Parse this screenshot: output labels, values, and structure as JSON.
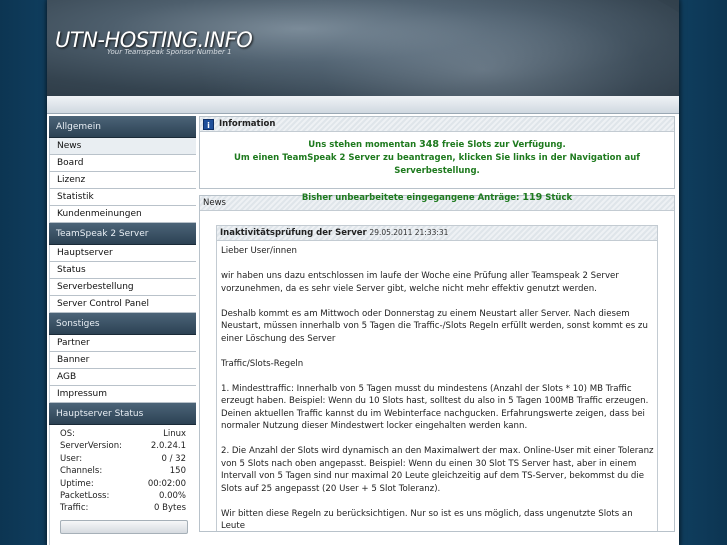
{
  "header": {
    "logo": "UTN-HOSTING.INFO",
    "tagline": "Your Teamspeak Sponsor Number 1"
  },
  "sidebar": {
    "sections": [
      {
        "title": "Allgemein",
        "items": [
          "News",
          "Board",
          "Lizenz",
          "Statistik",
          "Kundenmeinungen"
        ]
      },
      {
        "title": "TeamSpeak 2 Server",
        "items": [
          "Hauptserver",
          "Status",
          "Serverbestellung",
          "Server Control Panel"
        ]
      },
      {
        "title": "Sonstiges",
        "items": [
          "Partner",
          "Banner",
          "AGB",
          "Impressum"
        ]
      }
    ],
    "status": {
      "title": "Hauptserver Status",
      "rows": [
        {
          "label": "OS:",
          "value": "Linux"
        },
        {
          "label": "ServerVersion:",
          "value": "2.0.24.1"
        },
        {
          "label": "User:",
          "value": "0 / 32"
        },
        {
          "label": "Channels:",
          "value": "150"
        },
        {
          "label": "Uptime:",
          "value": "00:02:00"
        },
        {
          "label": "PacketLoss:",
          "value": "0.00%"
        },
        {
          "label": "Traffic:",
          "value": "0 Bytes"
        }
      ]
    }
  },
  "info": {
    "title": "Information",
    "line1_pre": "Uns stehen momentan",
    "free_slots": "348",
    "line1_post": "freie Slots zur Verfügung.",
    "line2": "Um einen TeamSpeak 2 Server zu beantragen, klicken Sie links in der Navigation auf Serverbestellung.",
    "line3_pre": "Bisher unbearbeitete eingegangene Anträge:",
    "pending": "119",
    "line3_post": "Stück"
  },
  "news": {
    "title": "News",
    "post": {
      "title": "Inaktivitätsprüfung der Server",
      "date": "29.05.2011 21:33:31",
      "paragraphs": [
        "Lieber User/innen",
        "wir haben uns dazu entschlossen im laufe der Woche eine Prüfung aller Teamspeak 2 Server vorzunehmen, da es sehr viele Server gibt, welche nicht mehr effektiv genutzt werden.",
        "Deshalb kommt es am Mittwoch oder Donnerstag zu einem Neustart aller Server. Nach diesem Neustart, müssen innerhalb von 5 Tagen die Traffic-/Slots Regeln erfüllt werden, sonst kommt es zu einer Löschung des Server",
        "Traffic/Slots-Regeln",
        "1. Mindesttraffic: Innerhalb von 5 Tagen musst du mindestens (Anzahl der Slots * 10) MB Traffic erzeugt haben. Beispiel: Wenn du 10 Slots hast, solltest du also in 5 Tagen 100MB Traffic erzeugen. Deinen aktuellen Traffic kannst du im Webinterface nachgucken. Erfahrungswerte zeigen, dass bei normaler Nutzung dieser Mindestwert locker eingehalten werden kann.",
        "2. Die Anzahl der Slots wird dynamisch an den Maximalwert der max. Online-User mit einer Toleranz von 5 Slots nach oben angepasst. Beispiel: Wenn du einen 30 Slot TS Server hast, aber in einem Intervall von 5 Tagen sind nur maximal 20 Leute gleichzeitig auf dem TS-Server, bekommst du die Slots auf 25 angepasst (20 User + 5 Slot Toleranz).",
        "Wir bitten diese Regeln zu berücksichtigen. Nur so ist es uns möglich, dass ungenutzte Slots an Leute"
      ]
    }
  }
}
